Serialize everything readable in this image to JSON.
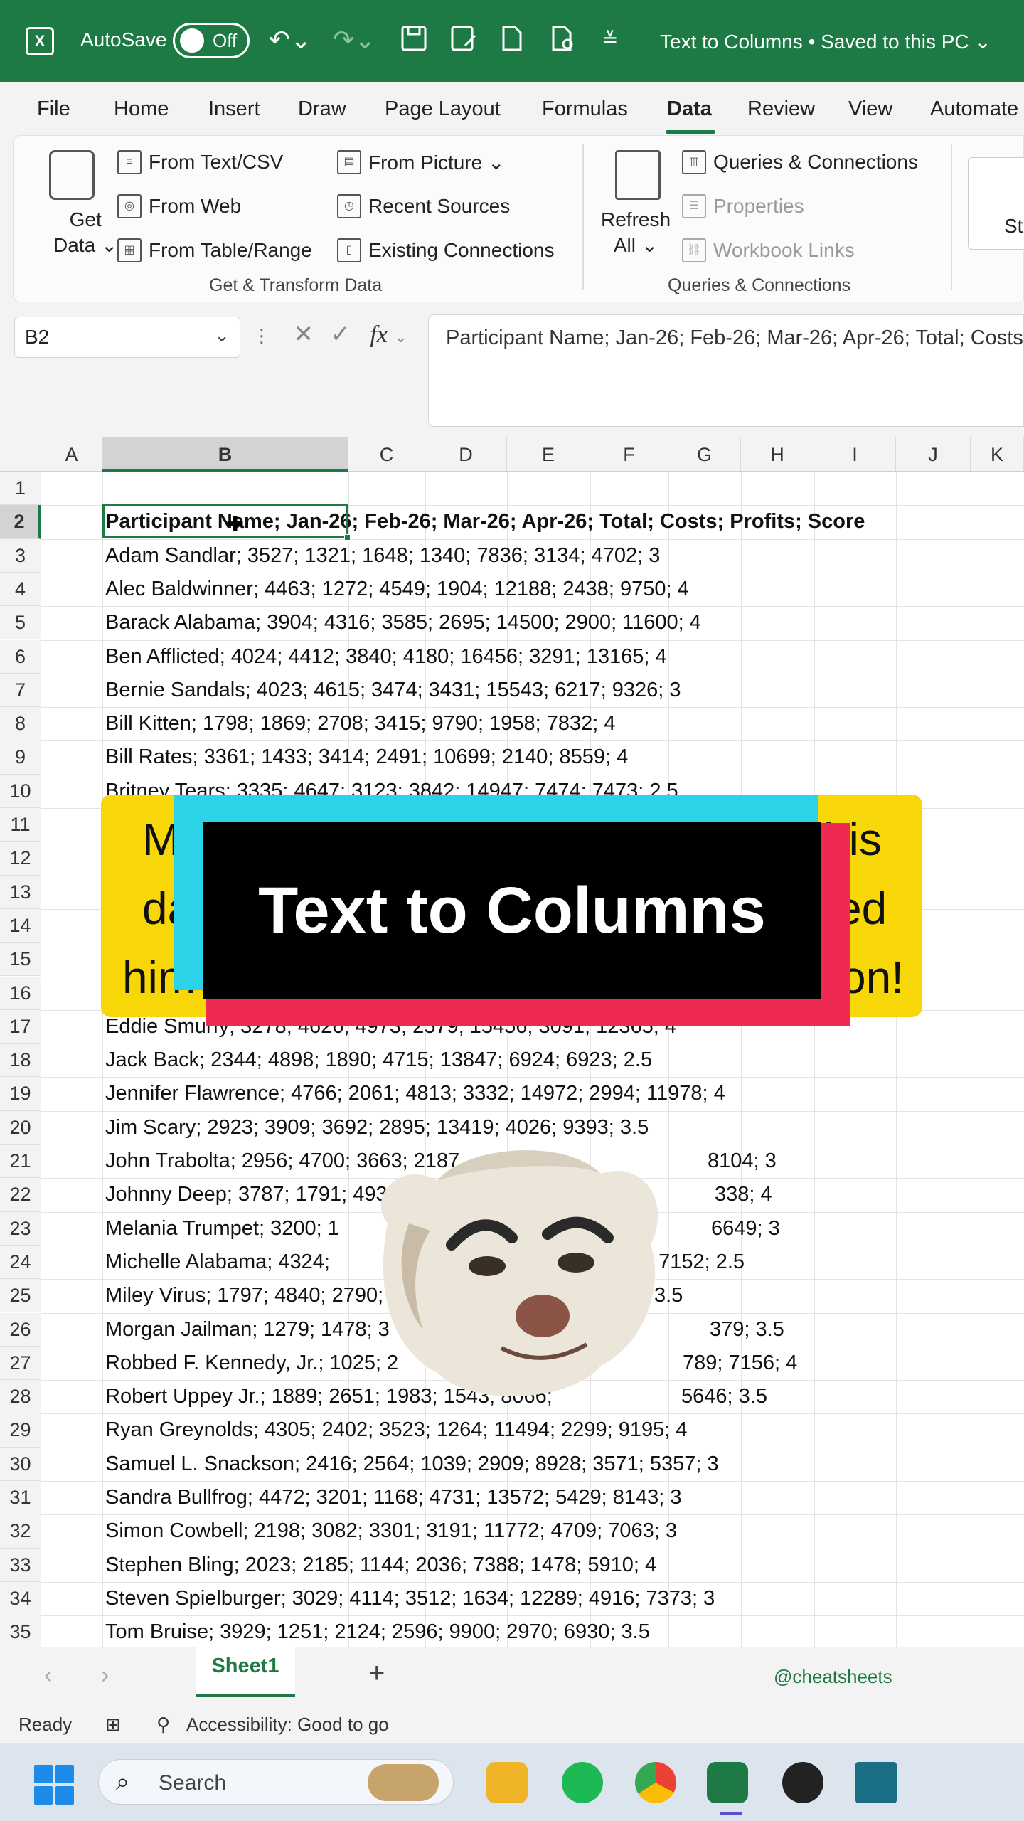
{
  "titlebar": {
    "app_glyph": "X",
    "autosave_label": "AutoSave",
    "autosave_state": "Off",
    "doc_title": "Text to Columns • Saved to this PC ⌄"
  },
  "menu": {
    "tabs": [
      "File",
      "Home",
      "Insert",
      "Draw",
      "Page Layout",
      "Formulas",
      "Data",
      "Review",
      "View",
      "Automate"
    ],
    "active_tab": "Data"
  },
  "ribbon": {
    "get_data_line1": "Get",
    "get_data_line2": "Data ⌄",
    "from_text_csv": "From Text/CSV",
    "from_web": "From Web",
    "from_table_range": "From Table/Range",
    "from_picture": "From Picture ⌄",
    "recent_sources": "Recent Sources",
    "existing_connections": "Existing Connections",
    "group1_label": "Get & Transform Data",
    "refresh_line1": "Refresh",
    "refresh_line2": "All ⌄",
    "queries_connections": "Queries & Connections",
    "properties": "Properties",
    "workbook_links": "Workbook Links",
    "group2_label": "Queries & Connections",
    "partial_label": "St"
  },
  "formula_bar": {
    "name_box": "B2",
    "formula": "Participant Name; Jan-26; Feb-26; Mar-26; Apr-26; Total; Costs; Profits; Score"
  },
  "grid": {
    "columns": [
      "A",
      "B",
      "C",
      "D",
      "E",
      "F",
      "G",
      "H",
      "I",
      "J",
      "K"
    ],
    "selected_column": "B",
    "selected_row": 2,
    "rows": [
      {
        "num": "1",
        "text": ""
      },
      {
        "num": "2",
        "text": "Participant Name; Jan-26; Feb-26; Mar-26; Apr-26; Total; Costs; Profits; Score"
      },
      {
        "num": "3",
        "text": "Adam Sandlar; 3527; 1321; 1648; 1340; 7836; 3134; 4702; 3"
      },
      {
        "num": "4",
        "text": "Alec Baldwinner; 4463; 1272; 4549; 1904; 12188; 2438; 9750; 4"
      },
      {
        "num": "5",
        "text": "Barack Alabama; 3904; 4316; 3585; 2695; 14500; 2900; 11600; 4"
      },
      {
        "num": "6",
        "text": "Ben Afflicted; 4024; 4412; 3840; 4180; 16456; 3291; 13165; 4"
      },
      {
        "num": "7",
        "text": "Bernie Sandals; 4023; 4615; 3474; 3431; 15543; 6217; 9326; 3"
      },
      {
        "num": "8",
        "text": "Bill Kitten; 1798; 1869; 2708; 3415; 9790; 1958; 7832; 4"
      },
      {
        "num": "9",
        "text": "Bill Rates; 3361; 1433; 3414; 2491; 10699; 2140; 8559; 4"
      },
      {
        "num": "10",
        "text": "Britney Tears; 3335; 4647; 3123; 3842; 14947; 7474; 7473; 2.5"
      },
      {
        "num": "11",
        "text": ""
      },
      {
        "num": "12",
        "text": ""
      },
      {
        "num": "13",
        "text": ""
      },
      {
        "num": "14",
        "text": ""
      },
      {
        "num": "15",
        "text": ""
      },
      {
        "num": "16",
        "text": ""
      },
      {
        "num": "17",
        "text": "Eddie Smurfy; 3278; 4626; 4973; 2579; 15456; 3091; 12365; 4"
      },
      {
        "num": "18",
        "text": "Jack Back; 2344; 4898; 1890; 4715; 13847; 6924; 6923; 2.5"
      },
      {
        "num": "19",
        "text": "Jennifer Flawrence; 4766; 2061; 4813; 3332; 14972; 2994; 11978; 4"
      },
      {
        "num": "20",
        "text": "Jim Scary; 2923; 3909; 3692; 2895; 13419; 4026; 9393; 3.5"
      },
      {
        "num": "21",
        "text": "John Trabolta; 2956; 4700; 3663; 2187"
      },
      {
        "num": "22",
        "text": "Johnny Deep; 3787; 1791; 4939"
      },
      {
        "num": "23",
        "text": "Melania Trumpet; 3200; 1"
      },
      {
        "num": "24",
        "text": "Michelle Alabama; 4324;"
      },
      {
        "num": "25",
        "text": "Miley Virus; 1797; 4840; 2790;"
      },
      {
        "num": "26",
        "text": "Morgan Jailman; 1279; 1478; 3"
      },
      {
        "num": "27",
        "text": "Robbed F. Kennedy, Jr.; 1025; 2"
      },
      {
        "num": "28",
        "text": "Robert Uppey Jr.; 1889; 2651; 1983; 1543; 8066;"
      },
      {
        "num": "29",
        "text": "Ryan Greynolds; 4305; 2402; 3523; 1264; 11494; 2299; 9195; 4"
      },
      {
        "num": "30",
        "text": "Samuel L. Snackson; 2416; 2564; 1039; 2909; 8928; 3571; 5357; 3"
      },
      {
        "num": "31",
        "text": "Sandra Bullfrog; 4472; 3201; 1168; 4731; 13572; 5429; 8143; 3"
      },
      {
        "num": "32",
        "text": "Simon Cowbell; 2198; 3082; 3301; 3191; 11772; 4709; 7063; 3"
      },
      {
        "num": "33",
        "text": "Stephen Bling; 2023; 2185; 1144; 2036; 7388; 1478; 5910; 4"
      },
      {
        "num": "34",
        "text": "Steven Spielburger; 3029; 4114; 3512; 1634; 12289; 4916; 7373; 3"
      },
      {
        "num": "35",
        "text": "Tom Bruise; 3929; 1251; 2124; 2596; 9900; 2970; 6930; 3.5"
      }
    ],
    "row_tail_fragments": {
      "r21": "8104; 3",
      "r22": "338; 4",
      "r23": "6649; 3",
      "r24": "; 7152; 2.5",
      "r25": "3.5",
      "r26": "379; 3.5",
      "r27": "789; 7156; 4",
      "r28": "5646; 3.5"
    }
  },
  "overlay": {
    "banner_title": "Text to Columns",
    "yellow_fragments": [
      "M",
      "his",
      "da",
      "ed",
      "him",
      "on!"
    ]
  },
  "sheetbar": {
    "prev": "‹",
    "next": "›",
    "active_sheet": "Sheet1",
    "add": "+",
    "watermark": "@cheatsheets"
  },
  "statusbar": {
    "ready": "Ready",
    "accessibility": "Accessibility: Good to go"
  },
  "taskbar": {
    "search_placeholder": "Search"
  },
  "colors": {
    "excel_green": "#1d7a45",
    "banner_yellow": "#f7d708",
    "banner_cyan": "#2bd3e9",
    "banner_red": "#ee2a53"
  }
}
